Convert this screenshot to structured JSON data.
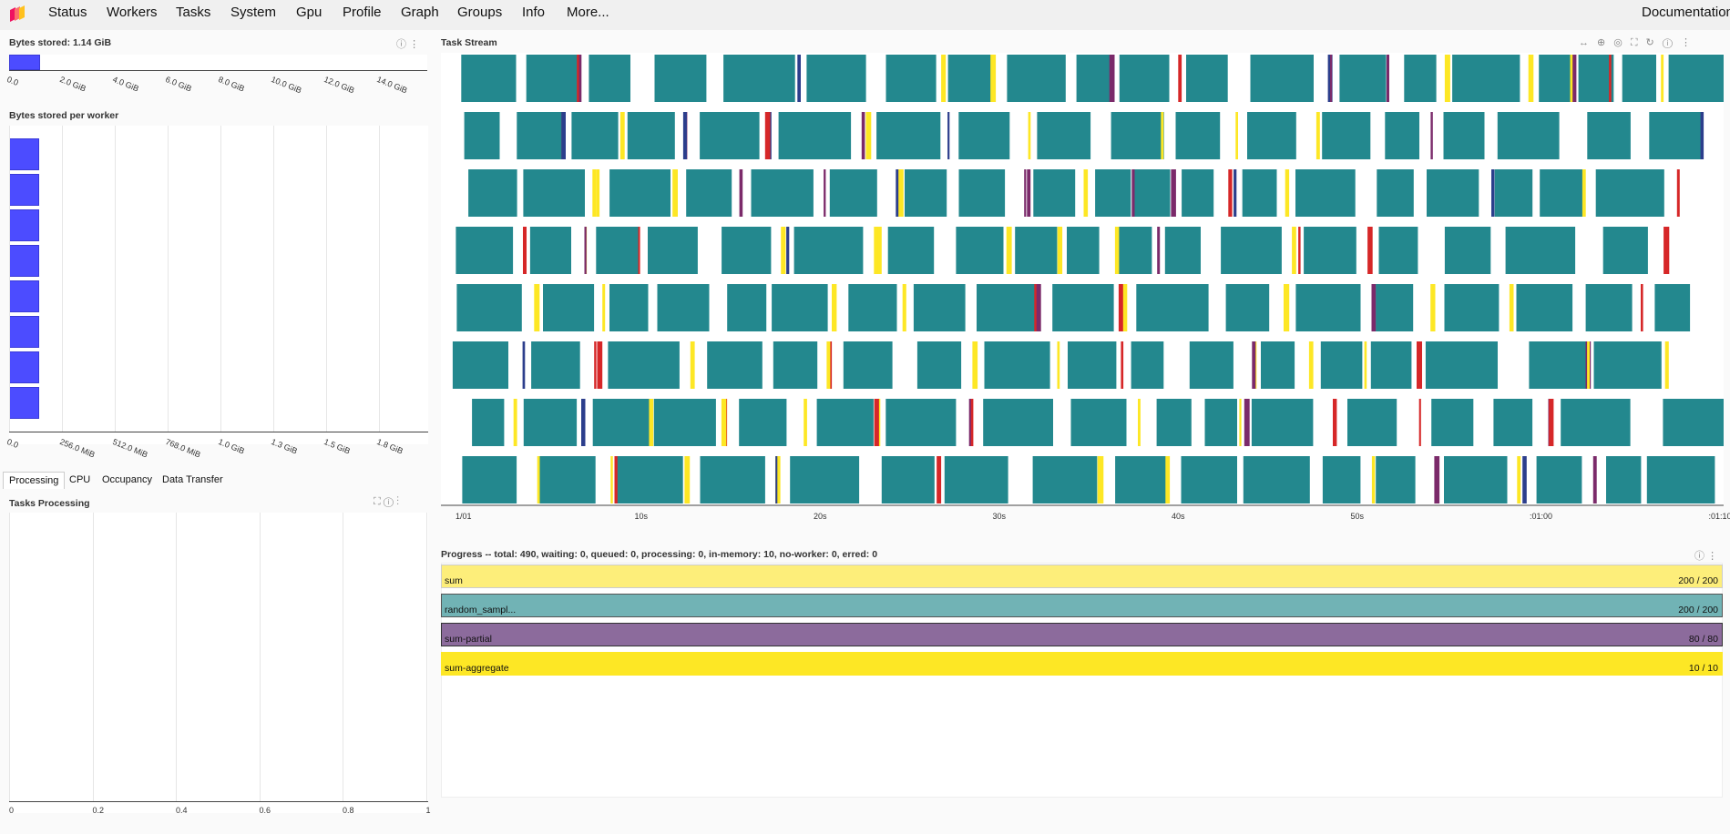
{
  "nav": {
    "items": [
      "Status",
      "Workers",
      "Tasks",
      "System",
      "Gpu",
      "Profile",
      "Graph",
      "Groups",
      "Info",
      "More..."
    ],
    "documentation": "Documentation"
  },
  "bytes_stored": {
    "title": "Bytes stored: 1.14 GiB",
    "value_gib": 1.14,
    "ticks": [
      "0.0",
      "2.0 GiB",
      "4.0 GiB",
      "6.0 GiB",
      "8.0 GiB",
      "10.0 GiB",
      "12.0 GiB",
      "14.0 GiB"
    ]
  },
  "bytes_per_worker": {
    "title": "Bytes stored per worker",
    "ticks": [
      "0.0",
      "256.0 MiB",
      "512.0 MiB",
      "768.0 MiB",
      "1.0 GiB",
      "1.3 GiB",
      "1.5 GiB",
      "1.8 GiB"
    ],
    "workers_count": 8
  },
  "tabs": [
    "Processing",
    "CPU",
    "Occupancy",
    "Data Transfer"
  ],
  "tasks_processing": {
    "title": "Tasks Processing",
    "ticks": [
      "0",
      "0.2",
      "0.4",
      "0.6",
      "0.8",
      "1"
    ]
  },
  "task_stream": {
    "title": "Task Stream",
    "ticks": [
      "1/01",
      "10s",
      "20s",
      "30s",
      "40s",
      "50s",
      ":01:00",
      ":01:10"
    ],
    "colors": {
      "random_sample": "#23888e",
      "sum": "#fde725",
      "sum-partial": "#7b2a6a",
      "other": "#d62728",
      "navy": "#2c3e8c"
    }
  },
  "progress": {
    "title": "Progress -- total: 490, waiting: 0, queued: 0, processing: 0, in-memory: 10, no-worker: 0, erred: 0",
    "rows": [
      {
        "name": "sum",
        "count": "200 / 200",
        "color": "#fdee7a"
      },
      {
        "name": "random_sampl...",
        "count": "200 / 200",
        "color": "#71b3b5"
      },
      {
        "name": "sum-partial",
        "count": "80 / 80",
        "color": "#8c6b9c"
      },
      {
        "name": "sum-aggregate",
        "count": "10 / 10",
        "color": "#fde725"
      }
    ]
  }
}
